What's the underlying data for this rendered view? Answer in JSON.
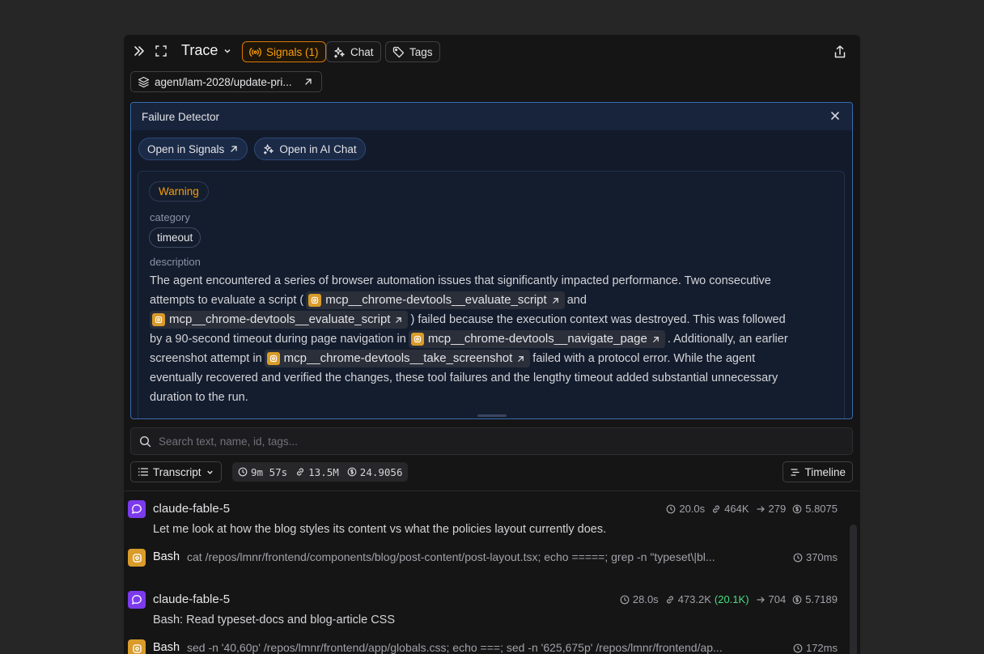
{
  "header": {
    "title": "Trace",
    "signals_label": "Signals (1)",
    "chat_label": "Chat",
    "tags_label": "Tags"
  },
  "path": {
    "label": "agent/lam-2028/update-pri..."
  },
  "detector": {
    "title": "Failure Detector",
    "open_signals": "Open in Signals",
    "open_chat": "Open in AI Chat",
    "severity": "Warning",
    "category_label": "category",
    "category_value": "timeout",
    "description_label": "description",
    "desc": {
      "l1": "The agent encountered a series of browser automation issues that significantly impacted performance. Two consecutive",
      "l2a": "attempts to evaluate a script (",
      "tool1": "mcp__chrome-devtools__evaluate_script",
      "l2b": "and",
      "tool2": "mcp__chrome-devtools__evaluate_script",
      "l3b": ") failed because the execution context was destroyed. This was followed",
      "l4a": "by a 90-second timeout during page navigation in",
      "tool3": "mcp__chrome-devtools__navigate_page",
      "l4b": ". Additionally, an earlier",
      "l5a": "screenshot attempt in",
      "tool4": "mcp__chrome-devtools__take_screenshot",
      "l5b": "failed with a protocol error. While the agent",
      "l6": "eventually recovered and verified the changes, these tool failures and the lengthy timeout added substantial unnecessary",
      "l7": "duration to the run."
    }
  },
  "search": {
    "placeholder": "Search text, name, id, tags..."
  },
  "toolbar": {
    "transcript_label": "Transcript",
    "duration": "9m 57s",
    "tokens": "13.5M",
    "cost": "24.9056",
    "timeline_label": "Timeline"
  },
  "messages": [
    {
      "name": "claude-fable-5",
      "time": "20.0s",
      "tokens_in": "464K",
      "tokens_out": "279",
      "cost": "5.8075",
      "text": "Let me look at how the blog styles its content vs what the policies layout currently does."
    },
    {
      "name": "claude-fable-5",
      "time": "28.0s",
      "tokens_in": "473.2K",
      "cached": "(20.1K)",
      "tokens_out": "704",
      "cost": "5.7189",
      "text": "Bash: Read typeset-docs and blog-article CSS"
    }
  ],
  "tool_calls": [
    {
      "name": "Bash",
      "command": "cat /repos/lmnr/frontend/components/blog/post-content/post-layout.tsx; echo =====; grep -n \"typeset\\|bl...",
      "duration": "370ms"
    },
    {
      "name": "Bash",
      "command": "sed -n '40,60p' /repos/lmnr/frontend/app/globals.css; echo ===; sed -n '625,675p' /repos/lmnr/frontend/ap...",
      "duration": "172ms"
    }
  ],
  "colors": {
    "accent_signal": "#f59e0b",
    "detector_border": "#3b6ab0",
    "avatar": "#7c3aed",
    "tool": "#d99b2a",
    "cached": "#4ade80"
  }
}
